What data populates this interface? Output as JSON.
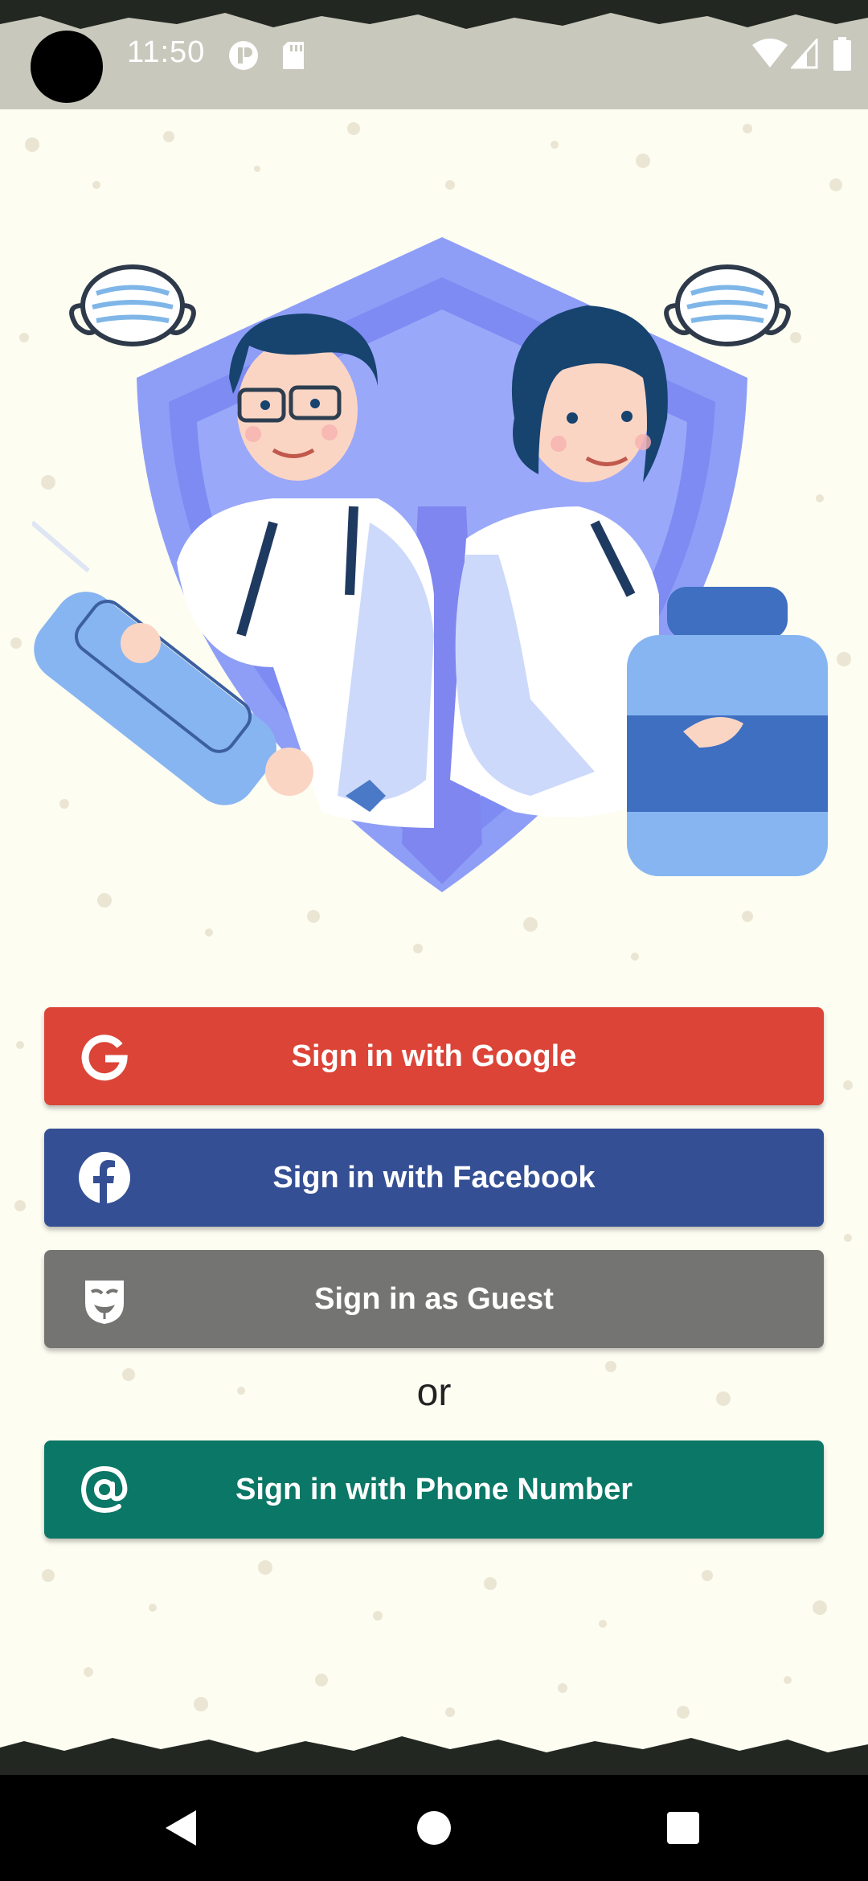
{
  "status_bar": {
    "time": "11:50"
  },
  "buttons": {
    "google": "Sign in with Google",
    "facebook": "Sign in with Facebook",
    "guest": "Sign in as Guest",
    "phone": "Sign in with Phone Number"
  },
  "separator": "or",
  "colors": {
    "google": "#db4437",
    "facebook": "#344f94",
    "guest": "#747472",
    "phone": "#0b7766",
    "background": "#fdfdf2"
  },
  "icons": {
    "google": "google-g-icon",
    "facebook": "facebook-icon",
    "guest": "guest-mask-icon",
    "phone": "at-sign-icon",
    "nav_back": "back-triangle-icon",
    "nav_home": "home-circle-icon",
    "nav_recents": "recents-square-icon"
  }
}
